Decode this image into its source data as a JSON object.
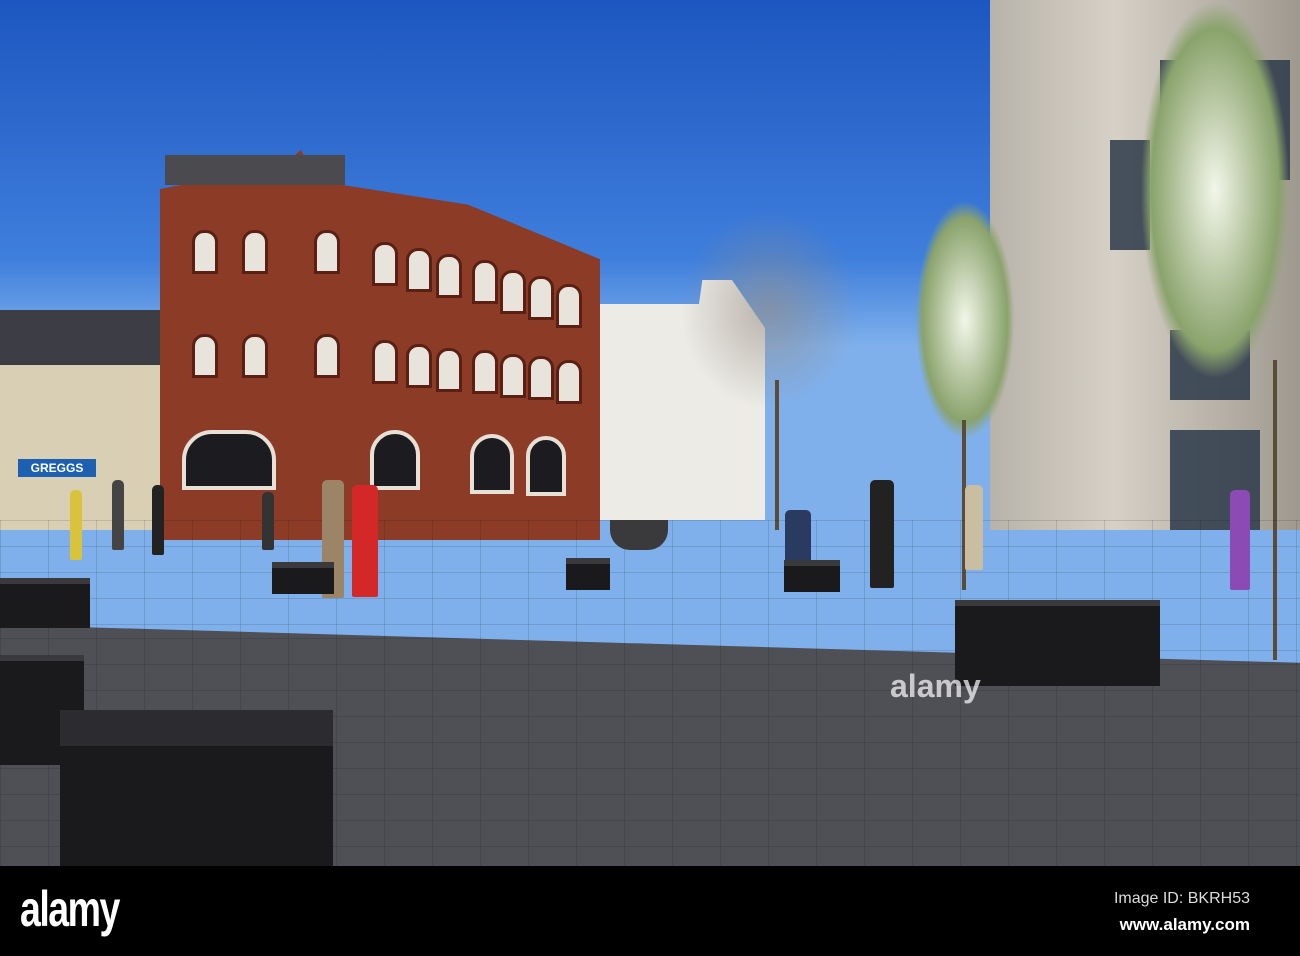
{
  "photo": {
    "shop_sign": "GREGGS",
    "watermark": "alamy"
  },
  "footer": {
    "logo": "alamy",
    "image_id": "Image ID: BKRH53",
    "url": "www.alamy.com"
  }
}
